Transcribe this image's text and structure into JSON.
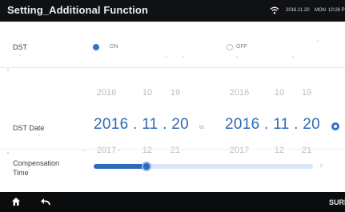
{
  "header": {
    "title": "Setting_Additional Function",
    "status_date": "2016.11.20",
    "status_day": "MON",
    "status_time": "10:26 P"
  },
  "dst": {
    "label": "DST",
    "on_label": "ON",
    "off_label": "OFF",
    "selected": "ON"
  },
  "dst_date": {
    "label": "DST Date",
    "connector": "to",
    "start": {
      "prev": [
        "2016",
        "10",
        "19"
      ],
      "current": "2016 . 11 . 20",
      "next": [
        "2017",
        "12",
        "21"
      ]
    },
    "end": {
      "prev": [
        "2016",
        "10",
        "19"
      ],
      "current": "2016 . 11 . 20",
      "next": [
        "2017",
        "12",
        "21"
      ]
    }
  },
  "compensation": {
    "label_line1": "Compensation",
    "label_line2": "Time",
    "value_fraction": 0.24,
    "end_value": "0"
  },
  "footer": {
    "sure_label": "SURE",
    "home_icon": "home-icon",
    "back_icon": "back-icon"
  },
  "colors": {
    "accent": "#2f6ab8",
    "bar": "#0f1114",
    "track": "#d9e6f6"
  }
}
